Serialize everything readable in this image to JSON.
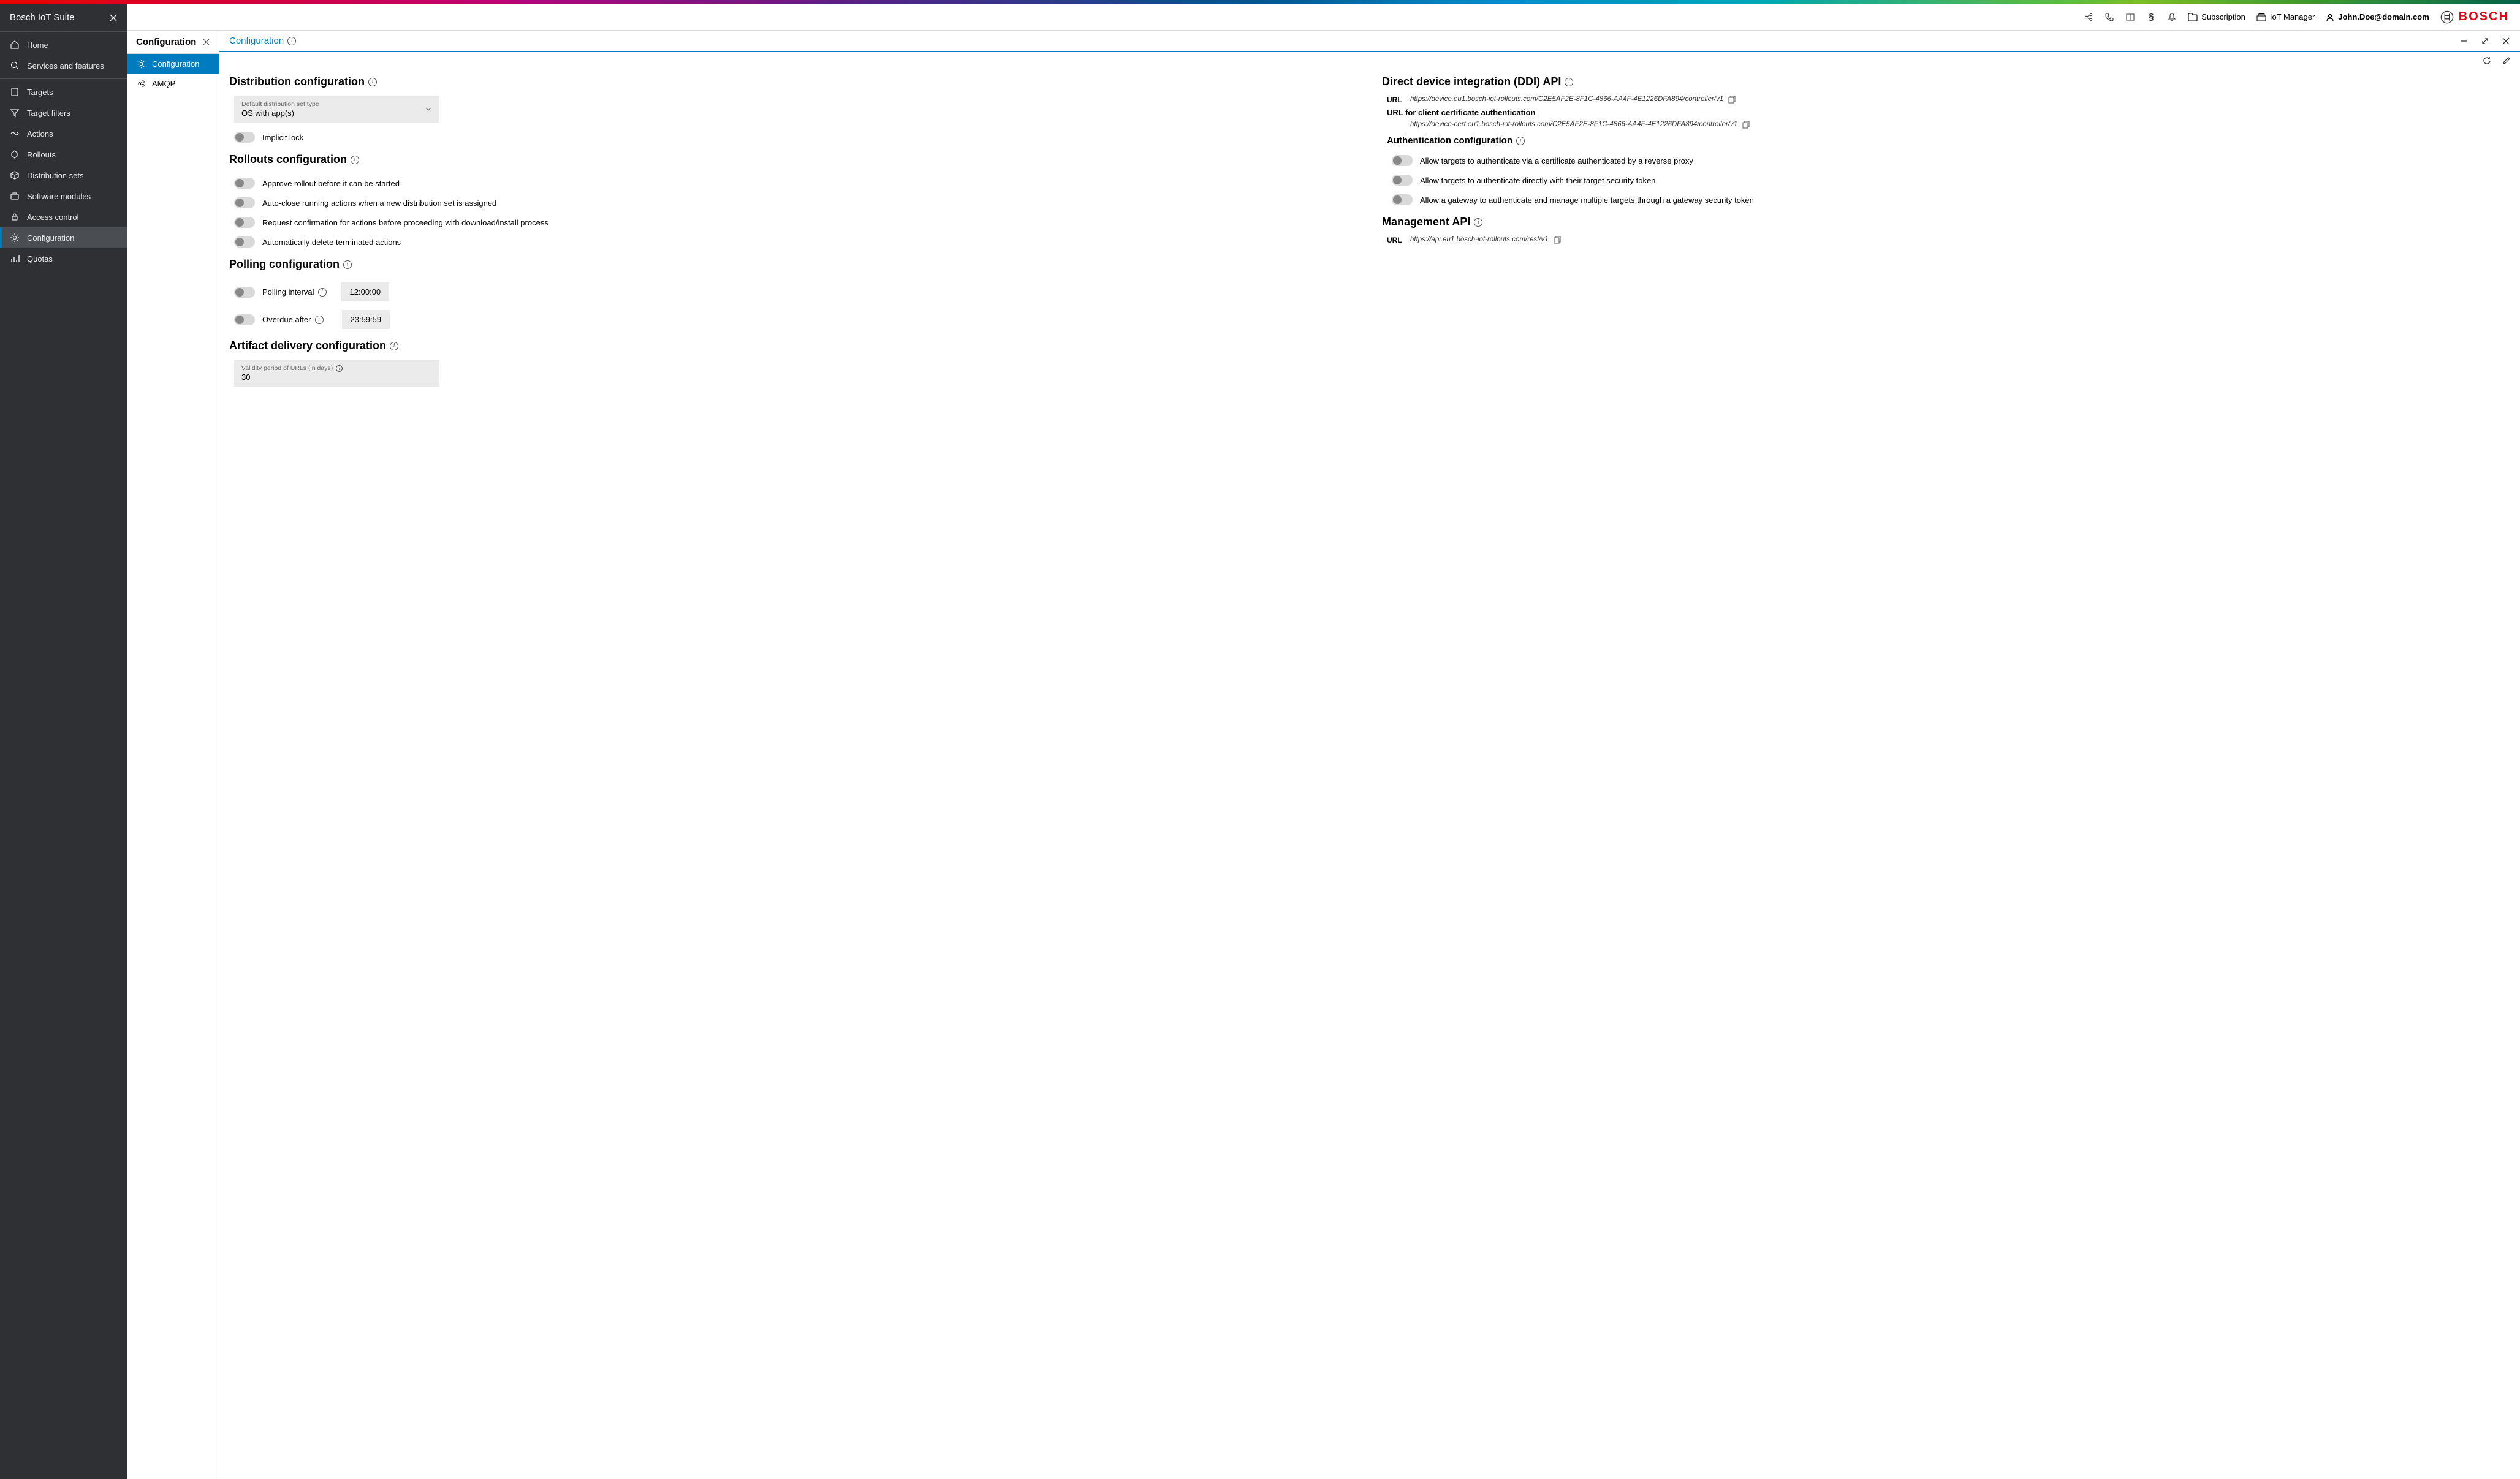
{
  "sidebar": {
    "title": "Bosch IoT Suite",
    "items": [
      {
        "label": "Home"
      },
      {
        "label": "Services and features"
      },
      {
        "label": "Targets"
      },
      {
        "label": "Target filters"
      },
      {
        "label": "Actions"
      },
      {
        "label": "Rollouts"
      },
      {
        "label": "Distribution sets"
      },
      {
        "label": "Software modules"
      },
      {
        "label": "Access control"
      },
      {
        "label": "Configuration"
      },
      {
        "label": "Quotas"
      }
    ]
  },
  "topbar": {
    "subscription": "Subscription",
    "iot_manager": "IoT Manager",
    "user": "John.Doe@domain.com",
    "brand": "BOSCH"
  },
  "subpanel": {
    "title": "Configuration",
    "items": [
      {
        "label": "Configuration"
      },
      {
        "label": "AMQP"
      }
    ]
  },
  "main": {
    "title": "Configuration",
    "left": {
      "distribution": {
        "heading": "Distribution configuration",
        "field_label": "Default distribution set type",
        "field_value": "OS with app(s)",
        "implicit_lock": "Implicit lock"
      },
      "rollouts": {
        "heading": "Rollouts configuration",
        "approve": "Approve rollout before it can be started",
        "autoclose": "Auto-close running actions when a new distribution set is assigned",
        "confirm": "Request confirmation for actions before proceeding with download/install process",
        "autodelete": "Automatically delete terminated actions"
      },
      "polling": {
        "heading": "Polling configuration",
        "interval_label": "Polling interval",
        "interval_value": "12:00:00",
        "overdue_label": "Overdue after",
        "overdue_value": "23:59:59"
      },
      "artifact": {
        "heading": "Artifact delivery configuration",
        "validity_label": "Validity period of URLs (in days)",
        "validity_value": "30"
      }
    },
    "right": {
      "ddi": {
        "heading": "Direct device integration (DDI) API",
        "url_label": "URL",
        "url": "https://device.eu1.bosch-iot-rollouts.com/C2E5AF2E-8F1C-4866-AA4F-4E1226DFA894/controller/v1",
        "cert_label": "URL for client certificate authentication",
        "cert_url": "https://device-cert.eu1.bosch-iot-rollouts.com/C2E5AF2E-8F1C-4866-AA4F-4E1226DFA894/controller/v1"
      },
      "auth": {
        "heading": "Authentication configuration",
        "reverse_proxy": "Allow targets to authenticate via a certificate authenticated by a reverse proxy",
        "security_token": "Allow targets to authenticate directly with their target security token",
        "gateway": "Allow a gateway to authenticate and manage multiple targets through a gateway security token"
      },
      "mgmt": {
        "heading": "Management API",
        "url_label": "URL",
        "url": "https://api.eu1.bosch-iot-rollouts.com/rest/v1"
      }
    }
  }
}
